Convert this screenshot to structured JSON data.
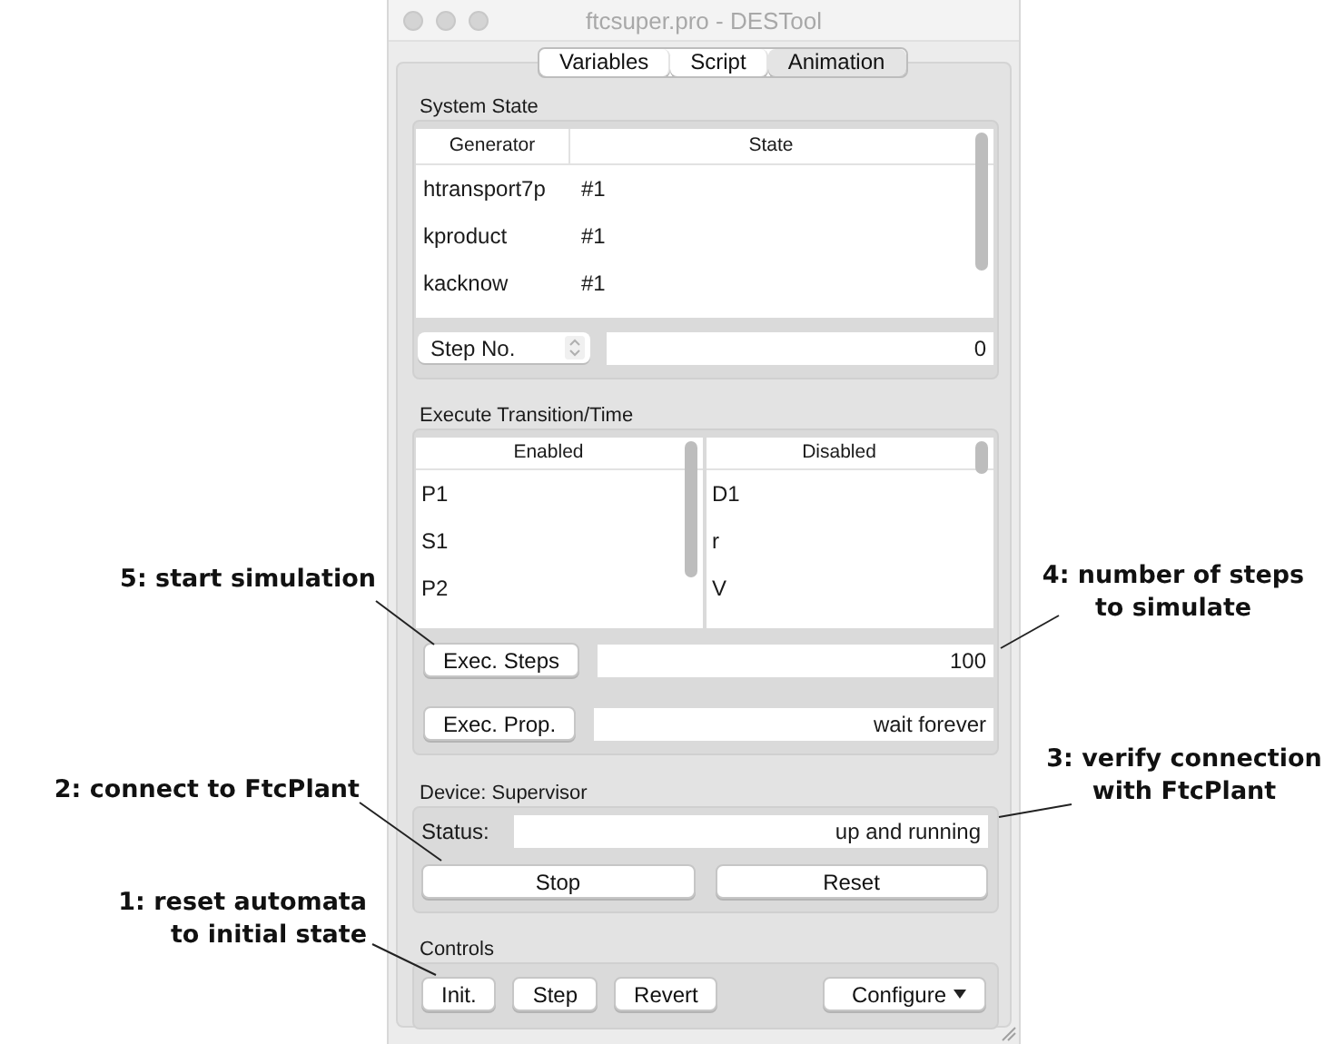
{
  "window": {
    "title": "ftcsuper.pro - DESTool"
  },
  "tabs": [
    {
      "label": "Variables",
      "selected": false
    },
    {
      "label": "Script",
      "selected": false
    },
    {
      "label": "Animation",
      "selected": true
    }
  ],
  "system_state": {
    "title": "System State",
    "columns": [
      "Generator",
      "State"
    ],
    "rows": [
      [
        "htransport7p",
        "#1"
      ],
      [
        "kproduct",
        "#1"
      ],
      [
        "kacknow",
        "#1"
      ]
    ],
    "step_select": {
      "value": "Step No."
    },
    "step_field": {
      "value": "0"
    }
  },
  "execute": {
    "title": "Execute Transition/Time",
    "lists": [
      {
        "heading": "Enabled",
        "items": [
          "P1",
          "S1",
          "P2"
        ]
      },
      {
        "heading": "Disabled",
        "items": [
          "D1",
          "r",
          "V"
        ]
      }
    ],
    "actions": [
      {
        "label": "Exec. Steps",
        "value": "100"
      },
      {
        "label": "Exec. Prop.",
        "value": "wait forever"
      }
    ]
  },
  "device": {
    "title": "Device: Supervisor",
    "status_label": "Status:",
    "status_value": "up and running",
    "buttons": [
      "Stop",
      "Reset"
    ]
  },
  "controls": {
    "title": "Controls",
    "buttons": [
      {
        "label": "Init.",
        "kind": "plain"
      },
      {
        "label": "Step",
        "kind": "plain"
      },
      {
        "label": "Revert",
        "kind": "plain"
      },
      {
        "label": "Configure",
        "kind": "menu"
      }
    ]
  },
  "annotations": [
    {
      "lines": [
        "5: start simulation"
      ]
    },
    {
      "lines": [
        "2: connect to FtcPlant"
      ]
    },
    {
      "lines": [
        "1: reset automata",
        "to initial state"
      ]
    },
    {
      "lines": [
        "4: number of steps",
        "to simulate"
      ]
    },
    {
      "lines": [
        "3: verify connection",
        "with FtcPlant"
      ]
    }
  ]
}
